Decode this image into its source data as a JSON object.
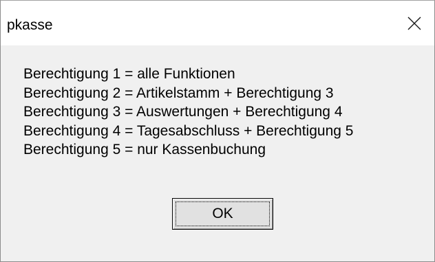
{
  "window": {
    "title": "pkasse"
  },
  "icons": {
    "close": "close-icon"
  },
  "message": {
    "lines": [
      "Berechtigung 1 = alle Funktionen",
      "Berechtigung 2 = Artikelstamm + Berechtigung 3",
      "Berechtigung 3 = Auswertungen + Berechtigung 4",
      "Berechtigung 4 = Tagesabschluss + Berechtigung 5",
      "Berechtigung 5 = nur Kassenbuchung"
    ]
  },
  "buttons": {
    "ok_label": "OK"
  },
  "colors": {
    "titlebar_bg": "#ffffff",
    "dialog_bg": "#f0f0f0",
    "button_bg": "#e1e1e1",
    "text": "#000000"
  }
}
